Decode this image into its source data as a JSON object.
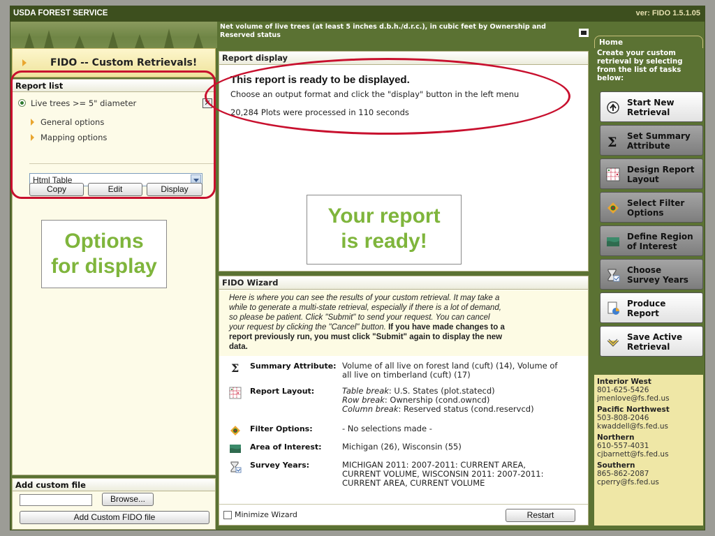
{
  "header": {
    "agency": "USDA FOREST SERVICE",
    "version": "ver: FIDO 1.5.1.05",
    "report_title": "Net volume of live trees (at least 5 inches d.b.h./d.r.c.), in cubic feet by Ownership and Reserved status"
  },
  "left": {
    "fido_title": "FIDO -- Custom Retrievals!",
    "report_list_head": "Report list",
    "report_item": "Live trees >= 5\" diameter",
    "close_label": "✕",
    "general_options": "General options",
    "mapping_options": "Mapping options",
    "output_format": "Html Table",
    "copy_label": "Copy",
    "edit_label": "Edit",
    "display_label": "Display",
    "callout_line1": "Options",
    "callout_line2": "for display",
    "add_file_head": "Add custom file",
    "browse_label": "Browse...",
    "add_file_button": "Add Custom FIDO file"
  },
  "report_display": {
    "head": "Report display",
    "title": "This report is ready to be displayed.",
    "subtitle": "Choose an output format and click the \"display\" button in the left menu",
    "stat": "20,284 Plots were processed in 110 seconds",
    "callout_line1": "Your report",
    "callout_line2": "is ready!"
  },
  "wizard": {
    "head": "FIDO Wizard",
    "text_line1": "Here is where you can see the results of your custom retrieval. It may take a",
    "text_line2": "while to generate a multi-state retrieval, especially if there is a lot of demand,",
    "text_line3": "so please be patient. Click \"Submit\" to send your request. You can cancel",
    "text_line4": "your request by clicking the \"Cancel\" button.",
    "text_bold1": "If you have made changes to a",
    "text_bold2": "report previously run, you must click \"Submit\" again to display the new",
    "text_bold3": "data.",
    "rows": [
      {
        "label": "Summary Attribute:",
        "line1": "Volume of all live on forest land (cuft) (14), Volume of",
        "line2": "all live on timberland (cuft) (17)",
        "line3": "",
        "icon": "sigma-icon"
      },
      {
        "label": "Report Layout:",
        "line1": "Table break: U.S. States (plot.statecd)",
        "line2": "Row break: Ownership (cond.owncd)",
        "line3": "Column break: Reserved status (cond.reservcd)",
        "icon": "layout-grid-icon"
      },
      {
        "label": "Filter Options:",
        "line1": "- No selections made -",
        "line2": "",
        "line3": "",
        "icon": "filter-icon"
      },
      {
        "label": "Area of Interest:",
        "line1": "Michigan (26), Wisconsin (55)",
        "line2": "",
        "line3": "",
        "icon": "map-icon"
      },
      {
        "label": "Survey Years:",
        "line1": "MICHIGAN 2011: 2007-2011: CURRENT AREA,",
        "line2": "CURRENT VOLUME, WISCONSIN 2011: 2007-2011:",
        "line3": "CURRENT AREA, CURRENT VOLUME",
        "icon": "hourglass-icon"
      }
    ],
    "layout_prefix_table": "Table break",
    "layout_prefix_row": "Row break",
    "layout_prefix_col": "Column break",
    "minimize_label": "Minimize Wizard",
    "restart_label": "Restart"
  },
  "right": {
    "home_tab": "Home",
    "home_desc": "Create your custom retrieval by selecting from the list of tasks below:",
    "tasks": [
      {
        "label_line1": "Start New",
        "label_line2": "Retrieval",
        "icon": "start-icon"
      },
      {
        "label_line1": "Set Summary",
        "label_line2": "Attribute",
        "icon": "sigma-icon"
      },
      {
        "label_line1": "Design Report",
        "label_line2": "Layout",
        "icon": "layout-grid-icon"
      },
      {
        "label_line1": "Select Filter",
        "label_line2": "Options",
        "icon": "filter-icon"
      },
      {
        "label_line1": "Define Region",
        "label_line2": "of Interest",
        "icon": "map-icon"
      },
      {
        "label_line1": "Choose",
        "label_line2": "Survey Years",
        "icon": "hourglass-icon"
      },
      {
        "label_line1": "Produce",
        "label_line2": "Report",
        "icon": "report-icon"
      },
      {
        "label_line1": "Save Active",
        "label_line2": "Retrieval",
        "icon": "save-icon"
      }
    ],
    "contacts": [
      {
        "region": "Interior West",
        "phone": "801-625-5426",
        "email": "jmenlove@fs.fed.us"
      },
      {
        "region": "Pacific Northwest",
        "phone": "503-808-2046",
        "email": "kwaddell@fs.fed.us"
      },
      {
        "region": "Northern",
        "phone": "610-557-4031",
        "email": "cjbarnett@fs.fed.us"
      },
      {
        "region": "Southern",
        "phone": "865-862-2087",
        "email": "cperry@fs.fed.us"
      }
    ]
  },
  "colors": {
    "accent_green": "#5b7233",
    "annotation_red": "#c8102e",
    "callout_green": "#7fb53c",
    "contact_bg": "#efe7a6"
  }
}
